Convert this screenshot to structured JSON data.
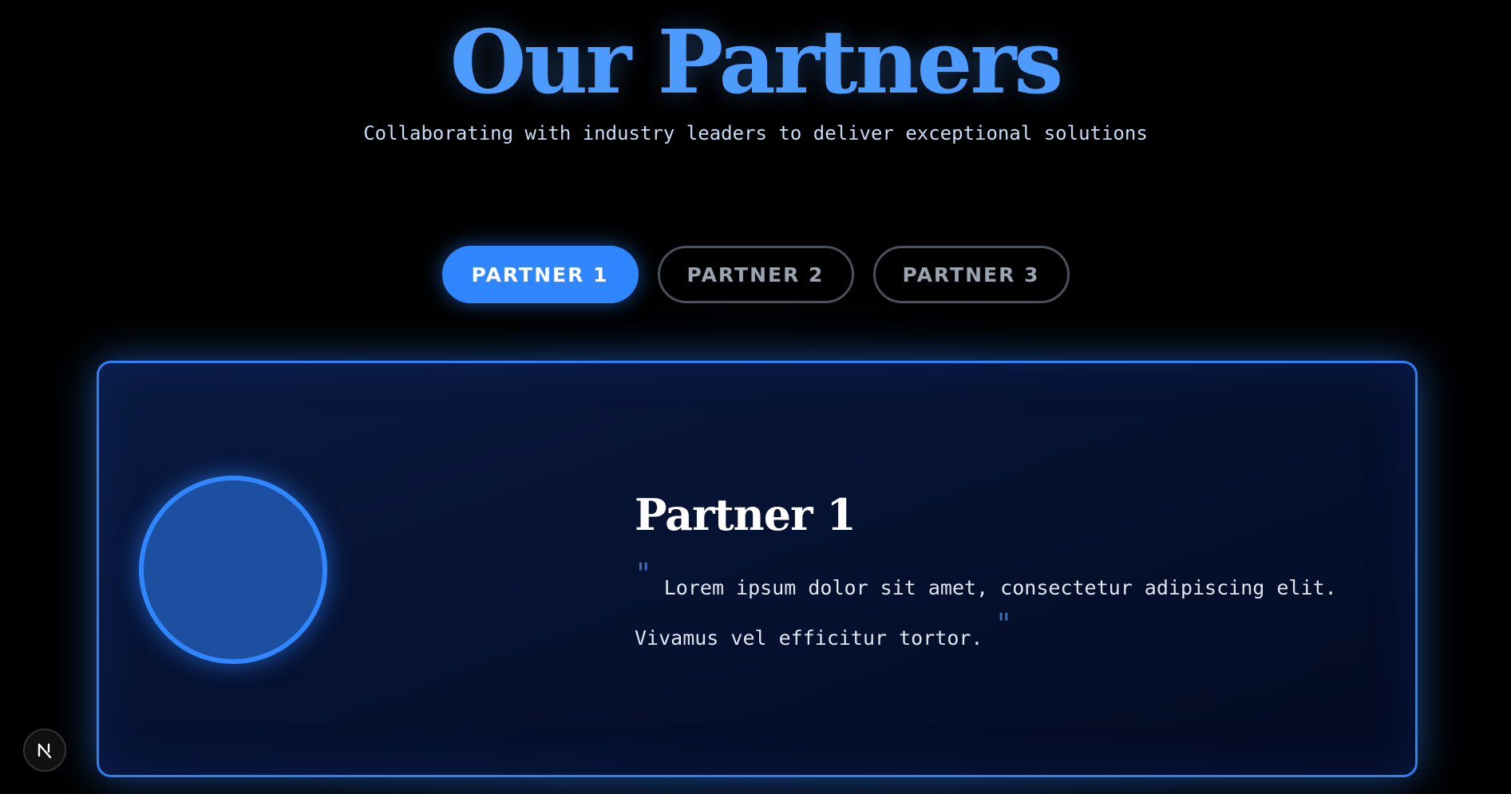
{
  "header": {
    "title": "Our Partners",
    "subtitle": "Collaborating with industry leaders to deliver exceptional solutions"
  },
  "tabs": [
    {
      "label": "PARTNER 1",
      "active": true
    },
    {
      "label": "PARTNER 2",
      "active": false
    },
    {
      "label": "PARTNER 3",
      "active": false
    }
  ],
  "card": {
    "name": "Partner 1",
    "quote_open": "\"",
    "quote_text": "Lorem ipsum dolor sit amet, consectetur adipiscing elit. Vivamus vel efficitur tortor.",
    "quote_close": "\""
  },
  "badge": {
    "icon": "nextjs-n-icon"
  },
  "colors": {
    "accent": "#2f86ff",
    "title": "#4d9bff",
    "background": "#000000",
    "card_border": "#2f7ff5"
  }
}
